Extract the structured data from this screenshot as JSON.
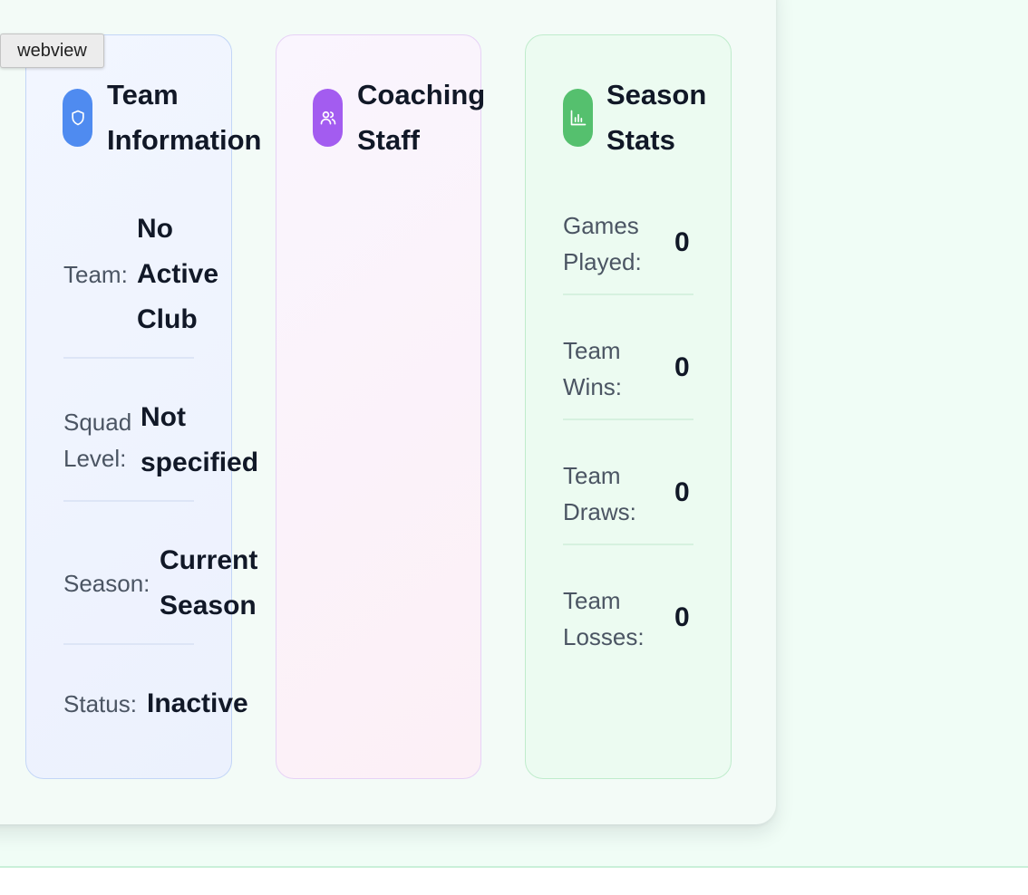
{
  "tooltip": {
    "text": "webview"
  },
  "team_info": {
    "title_line1": "Team",
    "title_line2": "Information",
    "icon": "shield-icon",
    "rows": [
      {
        "label": "Team:",
        "value_lines": [
          "No",
          "Active",
          "Club"
        ]
      },
      {
        "label_lines": [
          "Squad",
          "Level:"
        ],
        "value_lines": [
          "Not",
          "specified"
        ]
      },
      {
        "label": "Season:",
        "value_lines": [
          "Current",
          "Season"
        ]
      },
      {
        "label": "Status:",
        "value": "Inactive"
      }
    ]
  },
  "coaching_staff": {
    "title_line1": "Coaching",
    "title_line2": "Staff",
    "icon": "users-icon"
  },
  "season_stats": {
    "title_line1": "Season",
    "title_line2": "Stats",
    "icon": "bar-chart-icon",
    "rows": [
      {
        "label_lines": [
          "Games",
          "Played:"
        ],
        "value": "0"
      },
      {
        "label_lines": [
          "Team",
          "Wins:"
        ],
        "value": "0"
      },
      {
        "label_lines": [
          "Team",
          "Draws:"
        ],
        "value": "0"
      },
      {
        "label_lines": [
          "Team",
          "Losses:"
        ],
        "value": "0"
      }
    ]
  },
  "colors": {
    "page_background": "#f0fdf6",
    "team_accent": "#4f8bf0",
    "coaching_accent": "#a35cf0",
    "stats_accent": "#55c06e",
    "label_text": "#4b5563",
    "value_text": "#111827"
  }
}
